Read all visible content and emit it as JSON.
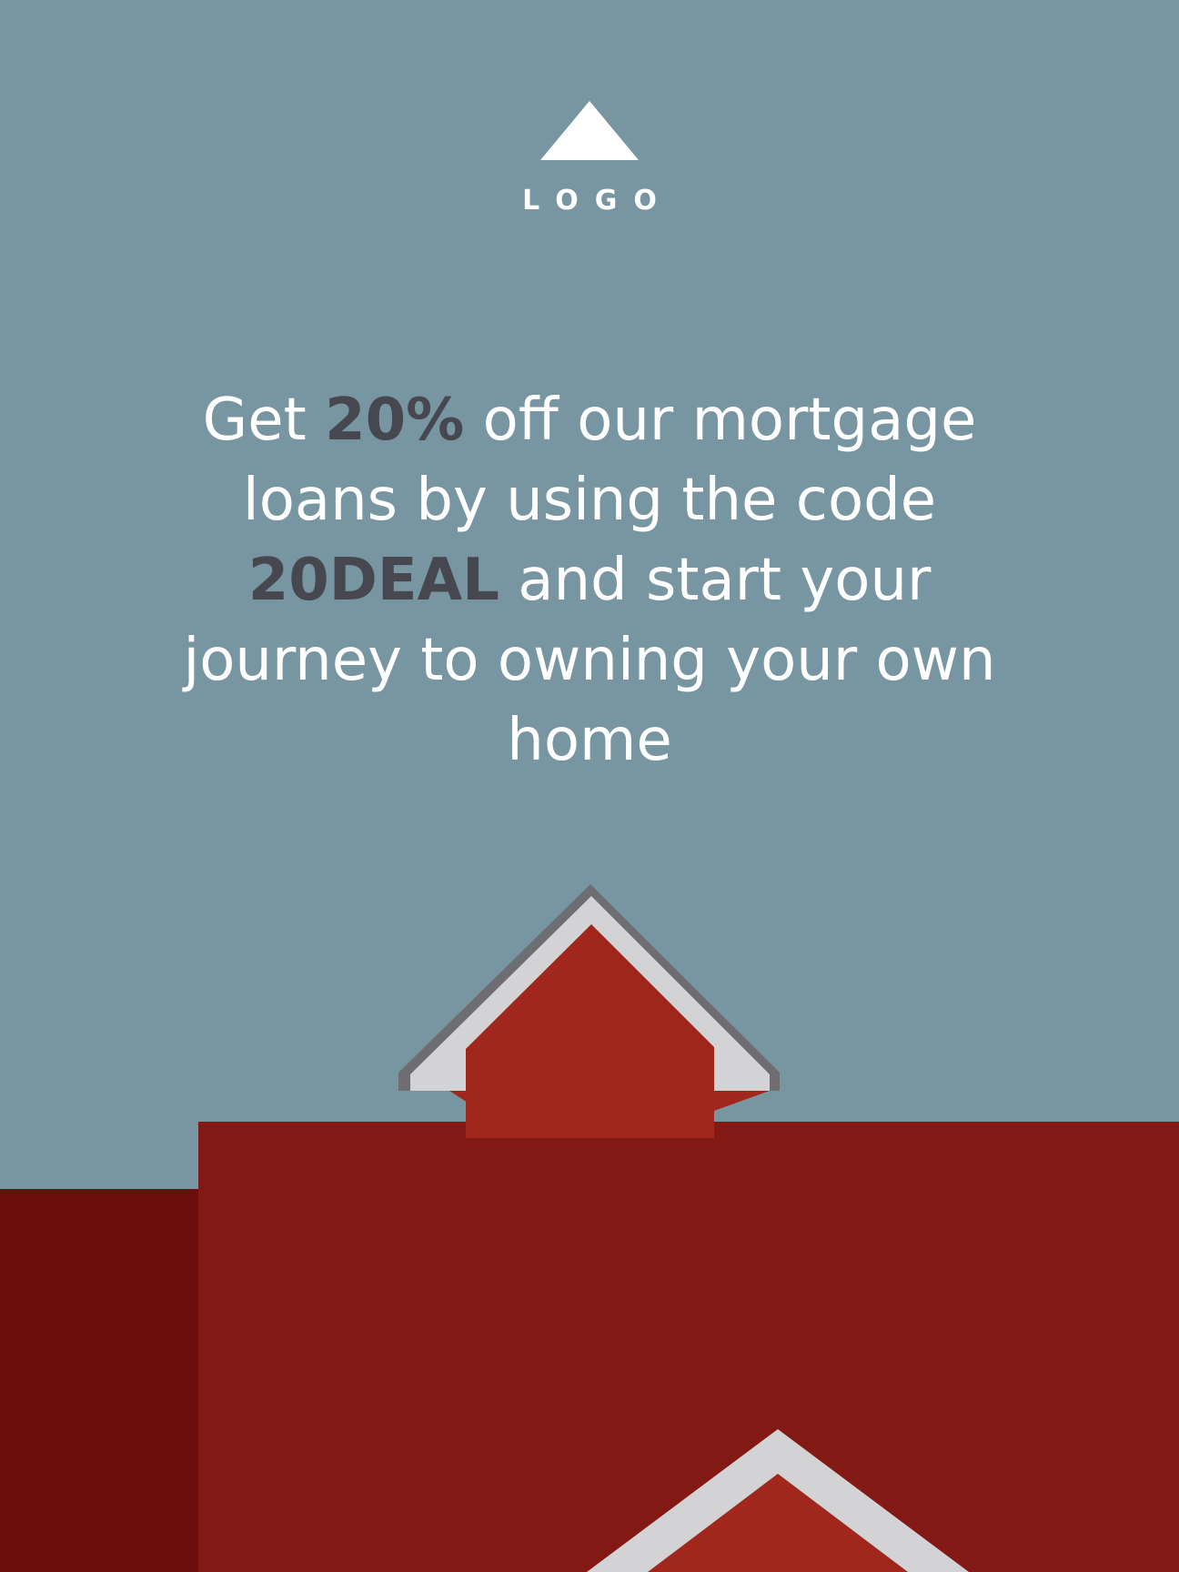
{
  "brand": {
    "logo_text": "LOGO",
    "logo_icon": "triangle-logo-icon"
  },
  "headline": {
    "part1": "Get ",
    "highlight1": "20%",
    "part2": " off our mortgage loans by using the code ",
    "highlight2": "20DEAL",
    "part3": " and start your journey to owning your own home"
  },
  "colors": {
    "background": "#7895a2",
    "text": "#ffffff",
    "highlight": "#46474f",
    "wall_front": "#821915",
    "wall_side": "#6c0e0b",
    "dormer_red": "#a1271c",
    "roof_trim_light": "#d3d3d5",
    "roof_trim_dark": "#6e6e72"
  },
  "illustration": {
    "icon": "house-roof-illustration"
  }
}
